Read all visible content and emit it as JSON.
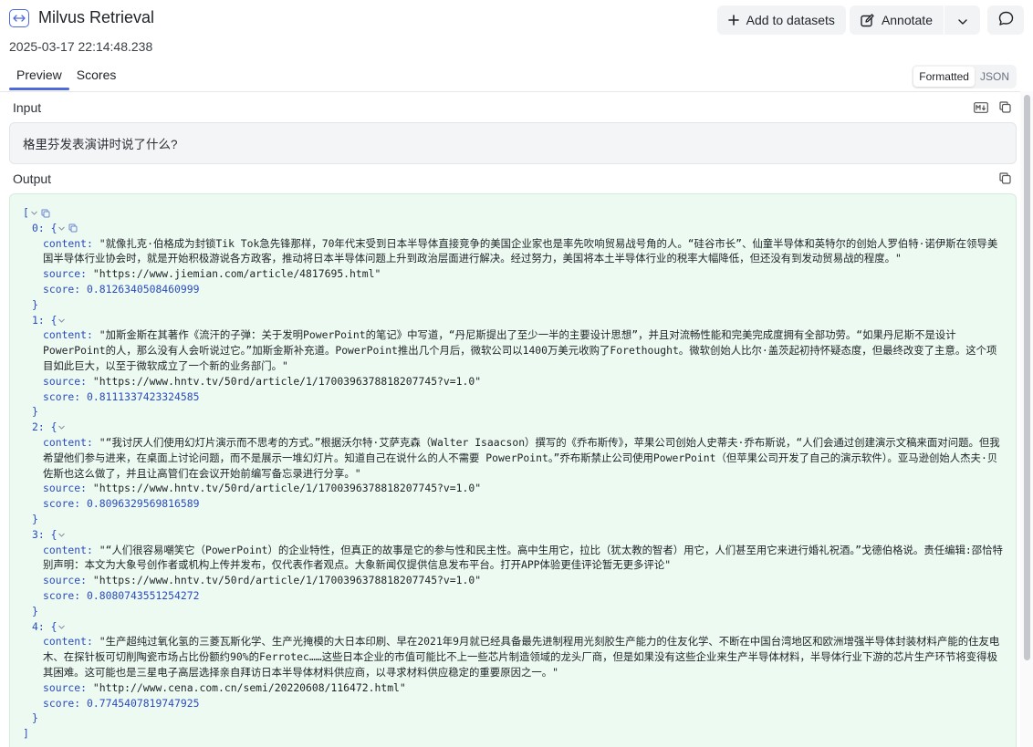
{
  "header": {
    "title": "Milvus Retrieval",
    "timestamp": "2025-03-17 22:14:48.238",
    "span_icon": "arrows-horizontal-icon"
  },
  "actions": {
    "add_to_datasets": "Add to datasets",
    "annotate": "Annotate"
  },
  "tabs": [
    {
      "label": "Preview",
      "active": true
    },
    {
      "label": "Scores",
      "active": false
    }
  ],
  "view_toggle": {
    "formatted": "Formatted",
    "json": "JSON",
    "selected": "Formatted"
  },
  "input": {
    "label": "Input",
    "text": "格里芬发表演讲时说了什么?"
  },
  "output": {
    "label": "Output",
    "items": [
      {
        "index": "0:",
        "content": "\"就像扎克·伯格成为封锁Tik Tok急先锋那样，70年代末受到日本半导体直接竞争的美国企业家也是率先吹响贸易战号角的人。“硅谷市长”、仙童半导体和英特尔的创始人罗伯特·诺伊斯在领导美国半导体行业协会时，就是开始积极游说各方政客，推动将日本半导体问题上升到政治层面进行解决。经过努力，美国将本土半导体行业的税率大幅降低，但还没有到发动贸易战的程度。\"",
        "source": "\"https://www.jiemian.com/article/4817695.html\"",
        "score": "0.8126340508460999"
      },
      {
        "index": "1:",
        "content": "\"加斯金斯在其著作《流汗的子弹：关于发明PowerPoint的笔记》中写道，“丹尼斯提出了至少一半的主要设计思想”，并且对流畅性能和完美完成度拥有全部功劳。“如果丹尼斯不是设计PowerPoint的人，那么没有人会听说过它。”加斯金斯补充道。PowerPoint推出几个月后，微软公司以1400万美元收购了Forethought。微软创始人比尔·盖茨起初持怀疑态度，但最终改变了主意。这个项目如此巨大，以至于微软成立了一个新的业务部门。\"",
        "source": "\"https://www.hntv.tv/50rd/article/1/1700396378818207745?v=1.0\"",
        "score": "0.8111337423324585"
      },
      {
        "index": "2:",
        "content": "\"“我讨厌人们使用幻灯片演示而不思考的方式。”根据沃尔特·艾萨克森（Walter Isaacson）撰写的《乔布斯传》，苹果公司创始人史蒂夫·乔布斯说，“人们会通过创建演示文稿来面对问题。但我希望他们参与进来，在桌面上讨论问题，而不是展示一堆幻灯片。知道自己在说什么的人不需要 PowerPoint。”乔布斯禁止公司使用PowerPoint（但苹果公司开发了自己的演示软件）。亚马逊创始人杰夫·贝佐斯也这么做了，并且让高管们在会议开始前编写备忘录进行分享。\"",
        "source": "\"https://www.hntv.tv/50rd/article/1/1700396378818207745?v=1.0\"",
        "score": "0.8096329569816589"
      },
      {
        "index": "3:",
        "content": "\"“人们很容易嘲笑它（PowerPoint）的企业特性，但真正的故事是它的参与性和民主性。高中生用它，拉比（犹太教的智者）用它，人们甚至用它来进行婚礼祝酒。”戈德伯格说。责任编辑:邵恰特别声明：本文为大象号创作者或机构上传并发布，仅代表作者观点。大象新闻仅提供信息发布平台。打开APP体验更佳评论暂无更多评论\"",
        "source": "\"https://www.hntv.tv/50rd/article/1/1700396378818207745?v=1.0\"",
        "score": "0.8080743551254272"
      },
      {
        "index": "4:",
        "content": "\"生产超纯过氧化氢的三菱瓦斯化学、生产光掩模的大日本印刷、早在2021年9月就已经具备最先进制程用光刻胶生产能力的住友化学、不断在中国台湾地区和欧洲增强半导体封装材料产能的住友电木、在探针板可切削陶瓷市场占比份额约90%的Ferrotec……这些日本企业的市值可能比不上一些芯片制造领域的龙头厂商，但是如果没有这些企业来生产半导体材料，半导体行业下游的芯片生产环节将变得极其困难。这可能也是三星电子高层选择亲自拜访日本半导体材料供应商，以寻求材料供应稳定的重要原因之一。\"",
        "source": "\"http://www.cena.com.cn/semi/20220608/116472.html\"",
        "score": "0.7745407819747925"
      }
    ]
  },
  "keys": {
    "content": "content:",
    "source": "source:",
    "score": "score:"
  },
  "json_brackets": {
    "open_array": "[",
    "close_array": "]",
    "open_obj": "{",
    "close_obj": "}"
  },
  "colors": {
    "accent": "#4f6bd8",
    "output_bg": "#edfaf1",
    "input_bg": "#f4f5f7"
  }
}
